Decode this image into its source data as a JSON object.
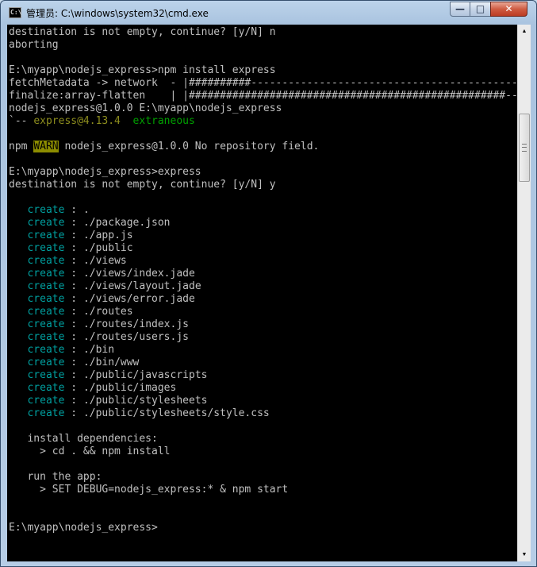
{
  "window": {
    "title": "管理员: C:\\windows\\system32\\cmd.exe",
    "icon_text": "C:\\",
    "controls": {
      "minimize": "—",
      "maximize": "□",
      "close": "✕"
    }
  },
  "console": {
    "lines": [
      [
        {
          "t": "destination is not empty, continue? [y/N] n"
        }
      ],
      [
        {
          "t": "aborting"
        }
      ],
      [
        {
          "t": ""
        }
      ],
      [
        {
          "t": "E:\\myapp\\nodejs_express>npm install express"
        }
      ],
      [
        {
          "t": "fetchMetadata -> network  - |##########---------------------------------------------|"
        }
      ],
      [
        {
          "t": "finalize:array-flatten    | |###################################################--------|"
        }
      ],
      [
        {
          "t": "nodejs_express@1.0.0 E:\\myapp\\nodejs_express"
        }
      ],
      [
        {
          "t": "`-- "
        },
        {
          "t": "express@4.13.4",
          "c": "olive"
        },
        {
          "t": "  "
        },
        {
          "t": "extraneous",
          "c": "green"
        }
      ],
      [
        {
          "t": ""
        }
      ],
      [
        {
          "t": "npm "
        },
        {
          "t": "WARN",
          "c": "warn"
        },
        {
          "t": " nodejs_express@1.0.0 No repository field."
        }
      ],
      [
        {
          "t": ""
        }
      ],
      [
        {
          "t": "E:\\myapp\\nodejs_express>express"
        }
      ],
      [
        {
          "t": "destination is not empty, continue? [y/N] y"
        }
      ],
      [
        {
          "t": ""
        }
      ],
      [
        {
          "t": "   "
        },
        {
          "t": "create",
          "c": "cyan"
        },
        {
          "t": " : ."
        }
      ],
      [
        {
          "t": "   "
        },
        {
          "t": "create",
          "c": "cyan"
        },
        {
          "t": " : ./package.json"
        }
      ],
      [
        {
          "t": "   "
        },
        {
          "t": "create",
          "c": "cyan"
        },
        {
          "t": " : ./app.js"
        }
      ],
      [
        {
          "t": "   "
        },
        {
          "t": "create",
          "c": "cyan"
        },
        {
          "t": " : ./public"
        }
      ],
      [
        {
          "t": "   "
        },
        {
          "t": "create",
          "c": "cyan"
        },
        {
          "t": " : ./views"
        }
      ],
      [
        {
          "t": "   "
        },
        {
          "t": "create",
          "c": "cyan"
        },
        {
          "t": " : ./views/index.jade"
        }
      ],
      [
        {
          "t": "   "
        },
        {
          "t": "create",
          "c": "cyan"
        },
        {
          "t": " : ./views/layout.jade"
        }
      ],
      [
        {
          "t": "   "
        },
        {
          "t": "create",
          "c": "cyan"
        },
        {
          "t": " : ./views/error.jade"
        }
      ],
      [
        {
          "t": "   "
        },
        {
          "t": "create",
          "c": "cyan"
        },
        {
          "t": " : ./routes"
        }
      ],
      [
        {
          "t": "   "
        },
        {
          "t": "create",
          "c": "cyan"
        },
        {
          "t": " : ./routes/index.js"
        }
      ],
      [
        {
          "t": "   "
        },
        {
          "t": "create",
          "c": "cyan"
        },
        {
          "t": " : ./routes/users.js"
        }
      ],
      [
        {
          "t": "   "
        },
        {
          "t": "create",
          "c": "cyan"
        },
        {
          "t": " : ./bin"
        }
      ],
      [
        {
          "t": "   "
        },
        {
          "t": "create",
          "c": "cyan"
        },
        {
          "t": " : ./bin/www"
        }
      ],
      [
        {
          "t": "   "
        },
        {
          "t": "create",
          "c": "cyan"
        },
        {
          "t": " : ./public/javascripts"
        }
      ],
      [
        {
          "t": "   "
        },
        {
          "t": "create",
          "c": "cyan"
        },
        {
          "t": " : ./public/images"
        }
      ],
      [
        {
          "t": "   "
        },
        {
          "t": "create",
          "c": "cyan"
        },
        {
          "t": " : ./public/stylesheets"
        }
      ],
      [
        {
          "t": "   "
        },
        {
          "t": "create",
          "c": "cyan"
        },
        {
          "t": " : ./public/stylesheets/style.css"
        }
      ],
      [
        {
          "t": ""
        }
      ],
      [
        {
          "t": "   install dependencies:"
        }
      ],
      [
        {
          "t": "     > cd . && npm install"
        }
      ],
      [
        {
          "t": ""
        }
      ],
      [
        {
          "t": "   run the app:"
        }
      ],
      [
        {
          "t": "     > SET DEBUG=nodejs_express:* & npm start"
        }
      ],
      [
        {
          "t": ""
        }
      ],
      [
        {
          "t": ""
        }
      ],
      [
        {
          "t": "E:\\myapp\\nodejs_express>"
        }
      ]
    ]
  },
  "scrollbar": {
    "up_arrow": "▲",
    "down_arrow": "▼"
  },
  "colors": {
    "console_bg": "#000000",
    "text": "#c0c0c0",
    "cyan": "#00a0a0",
    "green": "#00a000",
    "olive": "#8d8d1e",
    "warn_bg": "#8c8c00"
  }
}
